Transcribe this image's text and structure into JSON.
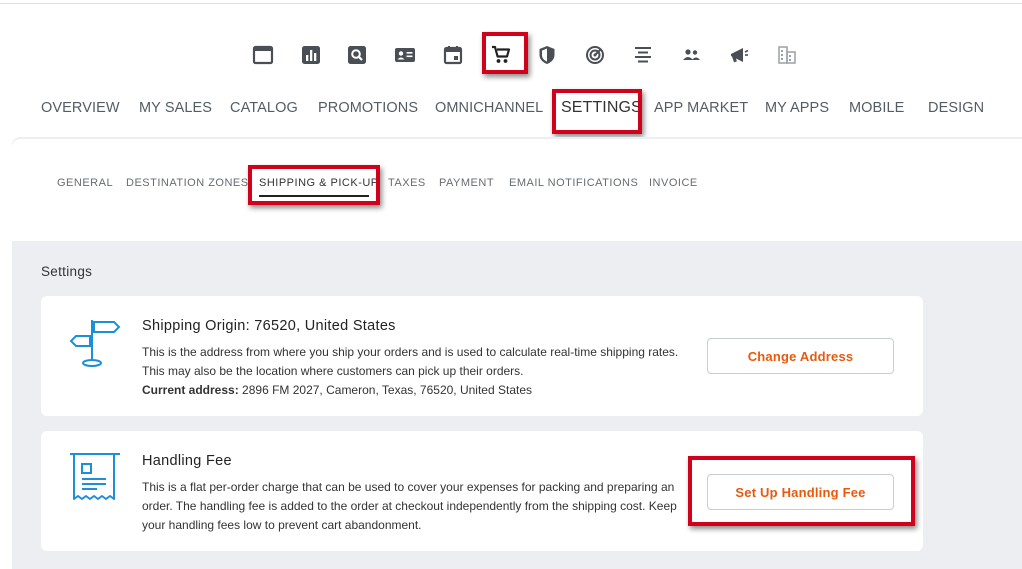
{
  "icons": [
    {
      "name": "window-icon"
    },
    {
      "name": "bar-chart-icon"
    },
    {
      "name": "search-icon"
    },
    {
      "name": "contact-card-icon"
    },
    {
      "name": "calendar-icon"
    },
    {
      "name": "shopping-cart-icon"
    },
    {
      "name": "shield-icon"
    },
    {
      "name": "target-icon"
    },
    {
      "name": "align-center-icon"
    },
    {
      "name": "people-icon"
    },
    {
      "name": "megaphone-icon"
    },
    {
      "name": "building-icon"
    }
  ],
  "main_nav": {
    "overview": "OVERVIEW",
    "my_sales": "MY SALES",
    "catalog": "CATALOG",
    "promotions": "PROMOTIONS",
    "omnichannel": "OMNICHANNEL",
    "settings": "SETTINGS",
    "app_market": "APP MARKET",
    "my_apps": "MY APPS",
    "mobile": "MOBILE",
    "design": "DESIGN"
  },
  "sub_nav": {
    "general": "GENERAL",
    "destination_zones": "DESTINATION ZONES",
    "shipping_pickup": "SHIPPING & PICK-UP",
    "taxes": "TAXES",
    "payment": "PAYMENT",
    "email_notifications": "EMAIL NOTIFICATIONS",
    "invoice": "INVOICE"
  },
  "section_title": "Settings",
  "shipping_origin": {
    "title": "Shipping Origin: 76520, United States",
    "description": "This is the address from where you ship your orders and is used to calculate real-time shipping rates. This may also be the location where customers can pick up their orders.",
    "current_address_label": "Current address:",
    "current_address_value": "2896 FM 2027, Cameron, Texas, 76520, United States",
    "button_label": "Change Address"
  },
  "handling_fee": {
    "title": "Handling Fee",
    "description": "This is a flat per-order charge that can be used to cover your expenses for packing and preparing an order. The handling fee is added to the order at checkout independently from the shipping cost. Keep your handling fees low to prevent cart abandonment.",
    "button_label": "Set Up Handling Fee"
  },
  "colors": {
    "accent_orange": "#e8590c",
    "highlight_red": "#d0021b",
    "icon_blue": "#1d8fd6",
    "icon_dark": "#4a4f55",
    "content_bg": "#eceef1"
  }
}
